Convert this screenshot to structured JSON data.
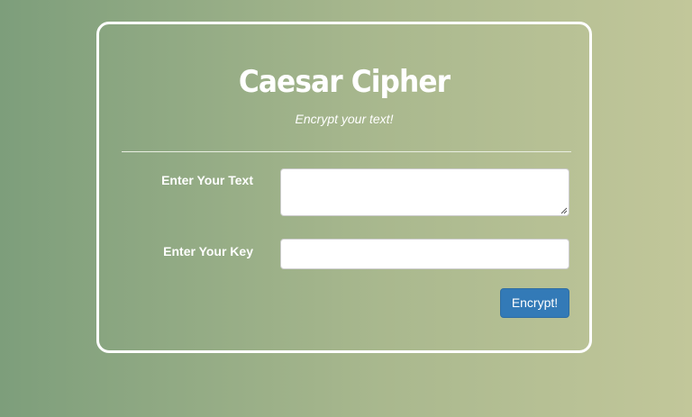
{
  "form": {
    "title": "Caesar Cipher",
    "subtitle": "Encrypt your text!",
    "text_label": "Enter Your Text",
    "text_value": "",
    "key_label": "Enter Your Key",
    "key_value": "",
    "submit_label": "Encrypt!"
  },
  "colors": {
    "background_start": "#7d9e7b",
    "background_end": "#c2c79a",
    "card_border": "#ffffff",
    "button": "#337ab7"
  }
}
